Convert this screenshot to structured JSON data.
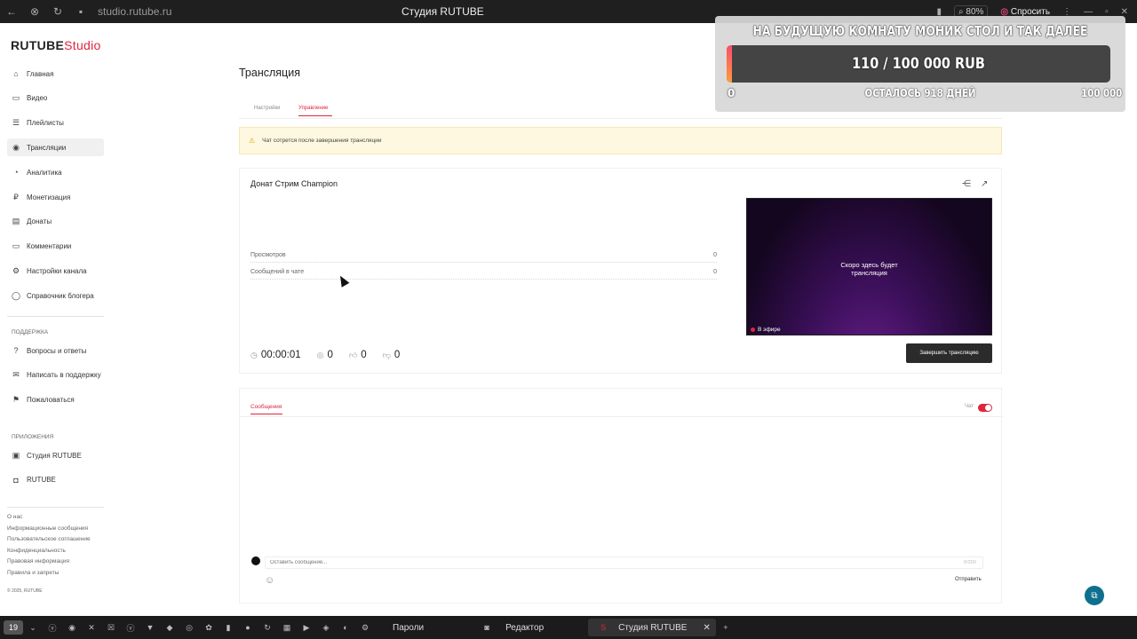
{
  "browser": {
    "url": "studio.rutube.ru",
    "title": "Студия RUTUBE",
    "zoom": "80%",
    "ask_label": "Спросить"
  },
  "sidebar": {
    "logo_main": "RUTUBE",
    "logo_studio": "Studio",
    "items": [
      {
        "label": "Главная",
        "icon": "home-icon"
      },
      {
        "label": "Видео",
        "icon": "video-icon"
      },
      {
        "label": "Плейлисты",
        "icon": "playlist-icon"
      },
      {
        "label": "Трансляции",
        "icon": "broadcast-icon"
      },
      {
        "label": "Аналитика",
        "icon": "analytics-icon"
      },
      {
        "label": "Монетизация",
        "icon": "ruble-icon"
      },
      {
        "label": "Донаты",
        "icon": "donate-icon"
      },
      {
        "label": "Комментарии",
        "icon": "comment-icon"
      },
      {
        "label": "Настройки канала",
        "icon": "gear-icon"
      },
      {
        "label": "Справочник блогера",
        "icon": "help-icon"
      }
    ],
    "support_heading": "ПОДДЕРЖКА",
    "support_items": [
      {
        "label": "Вопросы и ответы",
        "icon": "question-icon"
      },
      {
        "label": "Написать в поддержку",
        "icon": "mail-icon"
      },
      {
        "label": "Пожаловаться",
        "icon": "flag-icon"
      }
    ],
    "apps_heading": "ПРИЛОЖЕНИЯ",
    "apps_items": [
      {
        "label": "Студия RUTUBE",
        "icon": "studio-app-icon"
      },
      {
        "label": "RUTUBE",
        "icon": "rutube-app-icon"
      }
    ],
    "footer": [
      "О нас",
      "Информационные сообщения",
      "Пользовательское соглашение",
      "Конфиденциальность",
      "Правовая информация",
      "Правила и запреты",
      "© 2025, RUTUBE"
    ]
  },
  "main": {
    "title": "Трансляция",
    "tabs": [
      "Настройки",
      "Управление"
    ],
    "notice": "Чат сотрется после завершения трансляции",
    "stream": {
      "title": "Донат Стрим Champion",
      "stats": [
        {
          "label": "Просмотров",
          "value": "0"
        },
        {
          "label": "Сообщений в чате",
          "value": "0"
        }
      ],
      "preview_text_1": "Скоро здесь будет",
      "preview_text_2": "трансляция",
      "live_label": "В эфире",
      "duration": "00:00:01",
      "viewers": "0",
      "likes": "0",
      "dislikes": "0",
      "end_button": "Завершить трансляцию"
    },
    "chat": {
      "tab": "Сообщения",
      "toggle_label": "Чат",
      "toggle_on": true,
      "input_placeholder": "Оставить сообщение...",
      "counter": "0/200",
      "send_label": "Отправить"
    }
  },
  "donation_widget": {
    "goal": "НА БУДУЩУЮ КОМНАТУ МОНИК СТОЛ И ТАК ДАЛЕЕ",
    "amount": "110 / 100 000 RUB",
    "progress_fraction": 0.0011,
    "min": "0",
    "max": "100 000",
    "days_left": "ОСТАЛОСЬ 918 ДНЕЙ"
  },
  "taskbar": {
    "badge": "19",
    "items": [
      "Пароли",
      "Редактор",
      "Студия RUTUBE"
    ]
  }
}
